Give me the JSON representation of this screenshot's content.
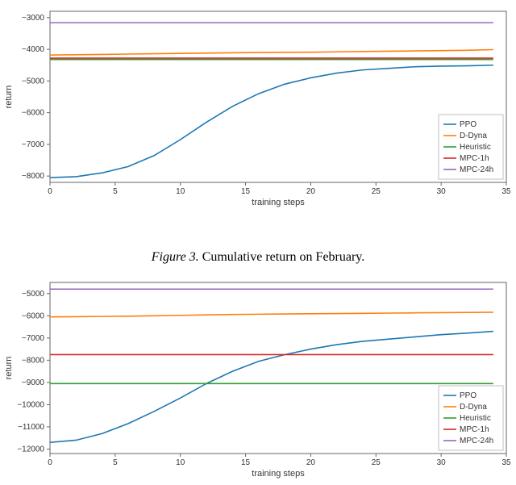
{
  "caption": {
    "fignum": "Figure 3.",
    "text": "Cumulative return on February."
  },
  "colors": {
    "PPO": "#1f77b4",
    "D-Dyna": "#ff7f0e",
    "Heuristic": "#2ca02c",
    "MPC-1h": "#d62728",
    "MPC-24h": "#9467bd"
  },
  "chart_data": [
    {
      "type": "line",
      "title": "",
      "xlabel": "training steps",
      "ylabel": "return",
      "xlim": [
        0,
        35
      ],
      "ylim": [
        -8200,
        -2800
      ],
      "xticks": [
        0,
        5,
        10,
        15,
        20,
        25,
        30,
        35
      ],
      "yticks": [
        -8000,
        -7000,
        -6000,
        -5000,
        -4000,
        -3000
      ],
      "x": [
        0,
        2,
        4,
        6,
        8,
        10,
        12,
        14,
        16,
        18,
        20,
        22,
        24,
        26,
        28,
        30,
        32,
        34
      ],
      "series": [
        {
          "name": "PPO",
          "color_key": "PPO",
          "values": [
            -8050,
            -8020,
            -7900,
            -7700,
            -7350,
            -6850,
            -6300,
            -5800,
            -5400,
            -5100,
            -4900,
            -4750,
            -4650,
            -4600,
            -4550,
            -4530,
            -4520,
            -4500
          ]
        },
        {
          "name": "D-Dyna",
          "color_key": "D-Dyna",
          "values": [
            -4180,
            -4170,
            -4160,
            -4150,
            -4140,
            -4130,
            -4120,
            -4110,
            -4100,
            -4095,
            -4090,
            -4080,
            -4070,
            -4060,
            -4050,
            -4040,
            -4030,
            -4010
          ]
        },
        {
          "name": "Heuristic",
          "color_key": "Heuristic",
          "values": [
            -4320,
            -4320,
            -4320,
            -4320,
            -4320,
            -4320,
            -4320,
            -4320,
            -4320,
            -4320,
            -4320,
            -4320,
            -4320,
            -4320,
            -4320,
            -4320,
            -4320,
            -4320
          ]
        },
        {
          "name": "MPC-1h",
          "color_key": "MPC-1h",
          "values": [
            -4280,
            -4280,
            -4280,
            -4280,
            -4280,
            -4280,
            -4280,
            -4280,
            -4280,
            -4280,
            -4280,
            -4280,
            -4280,
            -4280,
            -4280,
            -4280,
            -4280,
            -4280
          ]
        },
        {
          "name": "MPC-24h",
          "color_key": "MPC-24h",
          "values": [
            -3160,
            -3160,
            -3160,
            -3160,
            -3160,
            -3160,
            -3160,
            -3160,
            -3160,
            -3160,
            -3160,
            -3160,
            -3160,
            -3160,
            -3160,
            -3160,
            -3160,
            -3160
          ]
        }
      ],
      "legend": [
        "PPO",
        "D-Dyna",
        "Heuristic",
        "MPC-1h",
        "MPC-24h"
      ]
    },
    {
      "type": "line",
      "title": "",
      "xlabel": "training steps",
      "ylabel": "return",
      "xlim": [
        0,
        35
      ],
      "ylim": [
        -12200,
        -4500
      ],
      "xticks": [
        0,
        5,
        10,
        15,
        20,
        25,
        30,
        35
      ],
      "yticks": [
        -12000,
        -11000,
        -10000,
        -9000,
        -8000,
        -7000,
        -6000,
        -5000
      ],
      "x": [
        0,
        2,
        4,
        6,
        8,
        10,
        12,
        14,
        16,
        18,
        20,
        22,
        24,
        26,
        28,
        30,
        32,
        34
      ],
      "series": [
        {
          "name": "PPO",
          "color_key": "PPO",
          "values": [
            -11700,
            -11600,
            -11300,
            -10850,
            -10300,
            -9700,
            -9050,
            -8500,
            -8050,
            -7750,
            -7500,
            -7300,
            -7150,
            -7050,
            -6950,
            -6850,
            -6780,
            -6700
          ]
        },
        {
          "name": "D-Dyna",
          "color_key": "D-Dyna",
          "values": [
            -6050,
            -6040,
            -6030,
            -6020,
            -6000,
            -5980,
            -5960,
            -5940,
            -5930,
            -5920,
            -5910,
            -5900,
            -5890,
            -5880,
            -5870,
            -5860,
            -5850,
            -5840
          ]
        },
        {
          "name": "Heuristic",
          "color_key": "Heuristic",
          "values": [
            -9050,
            -9050,
            -9050,
            -9050,
            -9050,
            -9050,
            -9050,
            -9050,
            -9050,
            -9050,
            -9050,
            -9050,
            -9050,
            -9050,
            -9050,
            -9050,
            -9050,
            -9050
          ]
        },
        {
          "name": "MPC-1h",
          "color_key": "MPC-1h",
          "values": [
            -7750,
            -7750,
            -7750,
            -7750,
            -7750,
            -7750,
            -7750,
            -7750,
            -7750,
            -7750,
            -7750,
            -7750,
            -7750,
            -7750,
            -7750,
            -7750,
            -7750,
            -7750
          ]
        },
        {
          "name": "MPC-24h",
          "color_key": "MPC-24h",
          "values": [
            -4800,
            -4800,
            -4800,
            -4800,
            -4800,
            -4800,
            -4800,
            -4800,
            -4800,
            -4800,
            -4800,
            -4800,
            -4800,
            -4800,
            -4800,
            -4800,
            -4800,
            -4800
          ]
        }
      ],
      "legend": [
        "PPO",
        "D-Dyna",
        "Heuristic",
        "MPC-1h",
        "MPC-24h"
      ]
    }
  ]
}
